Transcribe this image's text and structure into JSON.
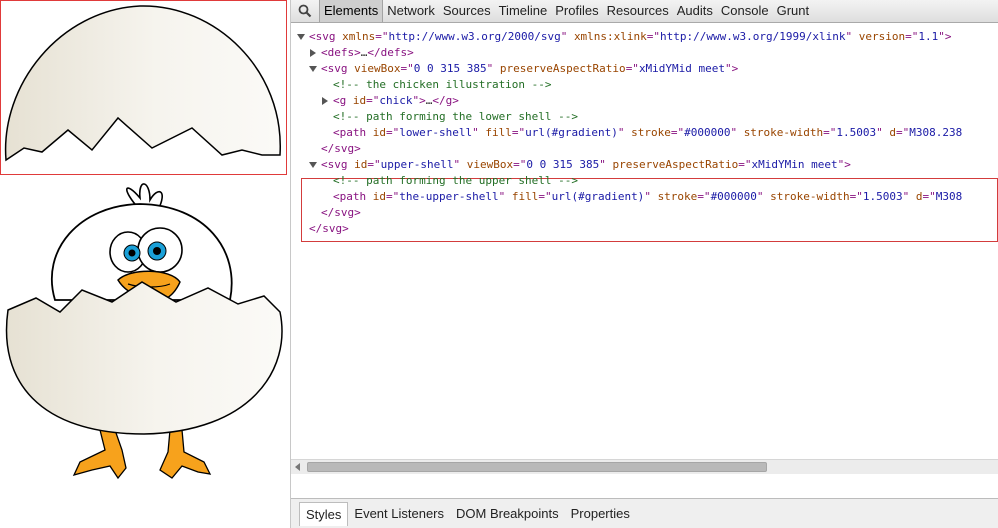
{
  "devtools": {
    "search_icon": "search-icon",
    "tabs": [
      {
        "label": "Elements",
        "active": true
      },
      {
        "label": "Network"
      },
      {
        "label": "Sources"
      },
      {
        "label": "Timeline"
      },
      {
        "label": "Profiles"
      },
      {
        "label": "Resources"
      },
      {
        "label": "Audits"
      },
      {
        "label": "Console"
      },
      {
        "label": "Grunt"
      }
    ],
    "bottom_tabs": [
      {
        "label": "Styles",
        "active": true
      },
      {
        "label": "Event Listeners"
      },
      {
        "label": "DOM Breakpoints"
      },
      {
        "label": "Properties"
      }
    ]
  },
  "dom": [
    {
      "indent": 0,
      "toggle": "down",
      "tokens": [
        [
          "tg",
          "<svg "
        ],
        [
          "an",
          "xmlns"
        ],
        [
          "tg",
          "=\""
        ],
        [
          "av",
          "http://www.w3.org/2000/svg"
        ],
        [
          "tg",
          "\" "
        ],
        [
          "an",
          "xmlns:xlink"
        ],
        [
          "tg",
          "=\""
        ],
        [
          "av",
          "http://www.w3.org/1999/xlink"
        ],
        [
          "tg",
          "\" "
        ],
        [
          "an",
          "version"
        ],
        [
          "tg",
          "=\""
        ],
        [
          "av",
          "1.1"
        ],
        [
          "tg",
          "\">"
        ]
      ]
    },
    {
      "indent": 1,
      "toggle": "right",
      "tokens": [
        [
          "tg",
          "<defs>"
        ],
        [
          "tx",
          "…"
        ],
        [
          "tg",
          "</defs>"
        ]
      ]
    },
    {
      "indent": 1,
      "toggle": "down",
      "tokens": [
        [
          "tg",
          "<svg "
        ],
        [
          "an",
          "viewBox"
        ],
        [
          "tg",
          "=\""
        ],
        [
          "av",
          "0 0 315 385"
        ],
        [
          "tg",
          "\" "
        ],
        [
          "an",
          "preserveAspectRatio"
        ],
        [
          "tg",
          "=\""
        ],
        [
          "av",
          "xMidYMid meet"
        ],
        [
          "tg",
          "\">"
        ]
      ]
    },
    {
      "indent": 2,
      "toggle": "",
      "tokens": [
        [
          "cm",
          "<!-- the chicken illustration -->"
        ]
      ]
    },
    {
      "indent": 2,
      "toggle": "right",
      "tokens": [
        [
          "tg",
          "<g "
        ],
        [
          "an",
          "id"
        ],
        [
          "tg",
          "=\""
        ],
        [
          "av",
          "chick"
        ],
        [
          "tg",
          "\">"
        ],
        [
          "tx",
          "…"
        ],
        [
          "tg",
          "</g>"
        ]
      ]
    },
    {
      "indent": 2,
      "toggle": "",
      "tokens": [
        [
          "cm",
          "<!-- path forming the lower shell -->"
        ]
      ]
    },
    {
      "indent": 2,
      "toggle": "",
      "tokens": [
        [
          "tg",
          "<path "
        ],
        [
          "an",
          "id"
        ],
        [
          "tg",
          "=\""
        ],
        [
          "av",
          "lower-shell"
        ],
        [
          "tg",
          "\" "
        ],
        [
          "an",
          "fill"
        ],
        [
          "tg",
          "=\""
        ],
        [
          "av",
          "url(#gradient)"
        ],
        [
          "tg",
          "\" "
        ],
        [
          "an",
          "stroke"
        ],
        [
          "tg",
          "=\""
        ],
        [
          "av",
          "#000000"
        ],
        [
          "tg",
          "\" "
        ],
        [
          "an",
          "stroke-width"
        ],
        [
          "tg",
          "=\""
        ],
        [
          "av",
          "1.5003"
        ],
        [
          "tg",
          "\" "
        ],
        [
          "an",
          "d"
        ],
        [
          "tg",
          "=\""
        ],
        [
          "av",
          "M308.238"
        ]
      ]
    },
    {
      "indent": 1,
      "toggle": "",
      "tokens": [
        [
          "tg",
          "</svg>"
        ]
      ]
    },
    {
      "indent": 1,
      "toggle": "down",
      "tokens": [
        [
          "tg",
          "<svg "
        ],
        [
          "an",
          "id"
        ],
        [
          "tg",
          "=\""
        ],
        [
          "av",
          "upper-shell"
        ],
        [
          "tg",
          "\" "
        ],
        [
          "an",
          "viewBox"
        ],
        [
          "tg",
          "=\""
        ],
        [
          "av",
          "0 0 315 385"
        ],
        [
          "tg",
          "\" "
        ],
        [
          "an",
          "preserveAspectRatio"
        ],
        [
          "tg",
          "=\""
        ],
        [
          "av",
          "xMidYMin meet"
        ],
        [
          "tg",
          "\">"
        ]
      ]
    },
    {
      "indent": 2,
      "toggle": "",
      "tokens": [
        [
          "cm",
          "<!-- path forming the upper shell -->"
        ]
      ]
    },
    {
      "indent": 2,
      "toggle": "",
      "tokens": [
        [
          "tg",
          "<path "
        ],
        [
          "an",
          "id"
        ],
        [
          "tg",
          "=\""
        ],
        [
          "av",
          "the-upper-shell"
        ],
        [
          "tg",
          "\" "
        ],
        [
          "an",
          "fill"
        ],
        [
          "tg",
          "=\""
        ],
        [
          "av",
          "url(#gradient)"
        ],
        [
          "tg",
          "\" "
        ],
        [
          "an",
          "stroke"
        ],
        [
          "tg",
          "=\""
        ],
        [
          "av",
          "#000000"
        ],
        [
          "tg",
          "\" "
        ],
        [
          "an",
          "stroke-width"
        ],
        [
          "tg",
          "=\""
        ],
        [
          "av",
          "1.5003"
        ],
        [
          "tg",
          "\" "
        ],
        [
          "an",
          "d"
        ],
        [
          "tg",
          "=\""
        ],
        [
          "av",
          "M308"
        ]
      ]
    },
    {
      "indent": 1,
      "toggle": "",
      "tokens": [
        [
          "tg",
          "</svg>"
        ]
      ]
    },
    {
      "indent": 0,
      "toggle": "",
      "tokens": [
        [
          "tg",
          "</svg>"
        ]
      ]
    }
  ]
}
